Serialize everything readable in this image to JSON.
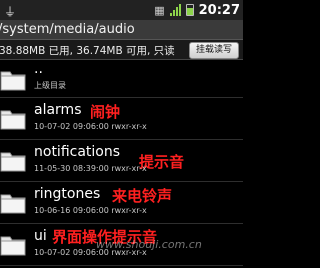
{
  "status_bar": {
    "usb_icon": "usb-icon",
    "sim_icon": "sim-card-icon",
    "signal_icon": "signal-strength-icon",
    "battery_icon": "battery-icon",
    "time": "20:27"
  },
  "path_bar": {
    "path": "/system/media/audio"
  },
  "info_bar": {
    "storage_text": "38.88MB 已用, 36.74MB 可用, 只读",
    "mount_button_label": "挂载读写"
  },
  "items": [
    {
      "name": "..",
      "meta": "上级目录",
      "annotation": ""
    },
    {
      "name": "alarms",
      "meta": "10-07-02 09:06:00  rwxr-xr-x",
      "annotation": "闹钟"
    },
    {
      "name": "notifications",
      "meta": "11-05-30 08:39:00  rwxr-xr-x",
      "annotation": "提示音"
    },
    {
      "name": "ringtones",
      "meta": "10-06-16 09:06:00  rwxr-xr-x",
      "annotation": "来电铃声"
    },
    {
      "name": "ui",
      "meta": "10-07-02 09:06:00  rwxr-xr-x",
      "annotation": "界面操作提示音"
    }
  ],
  "watermark": "www.shouji.com.cn",
  "colors": {
    "annotation": "#ff2020",
    "background": "#000000"
  }
}
